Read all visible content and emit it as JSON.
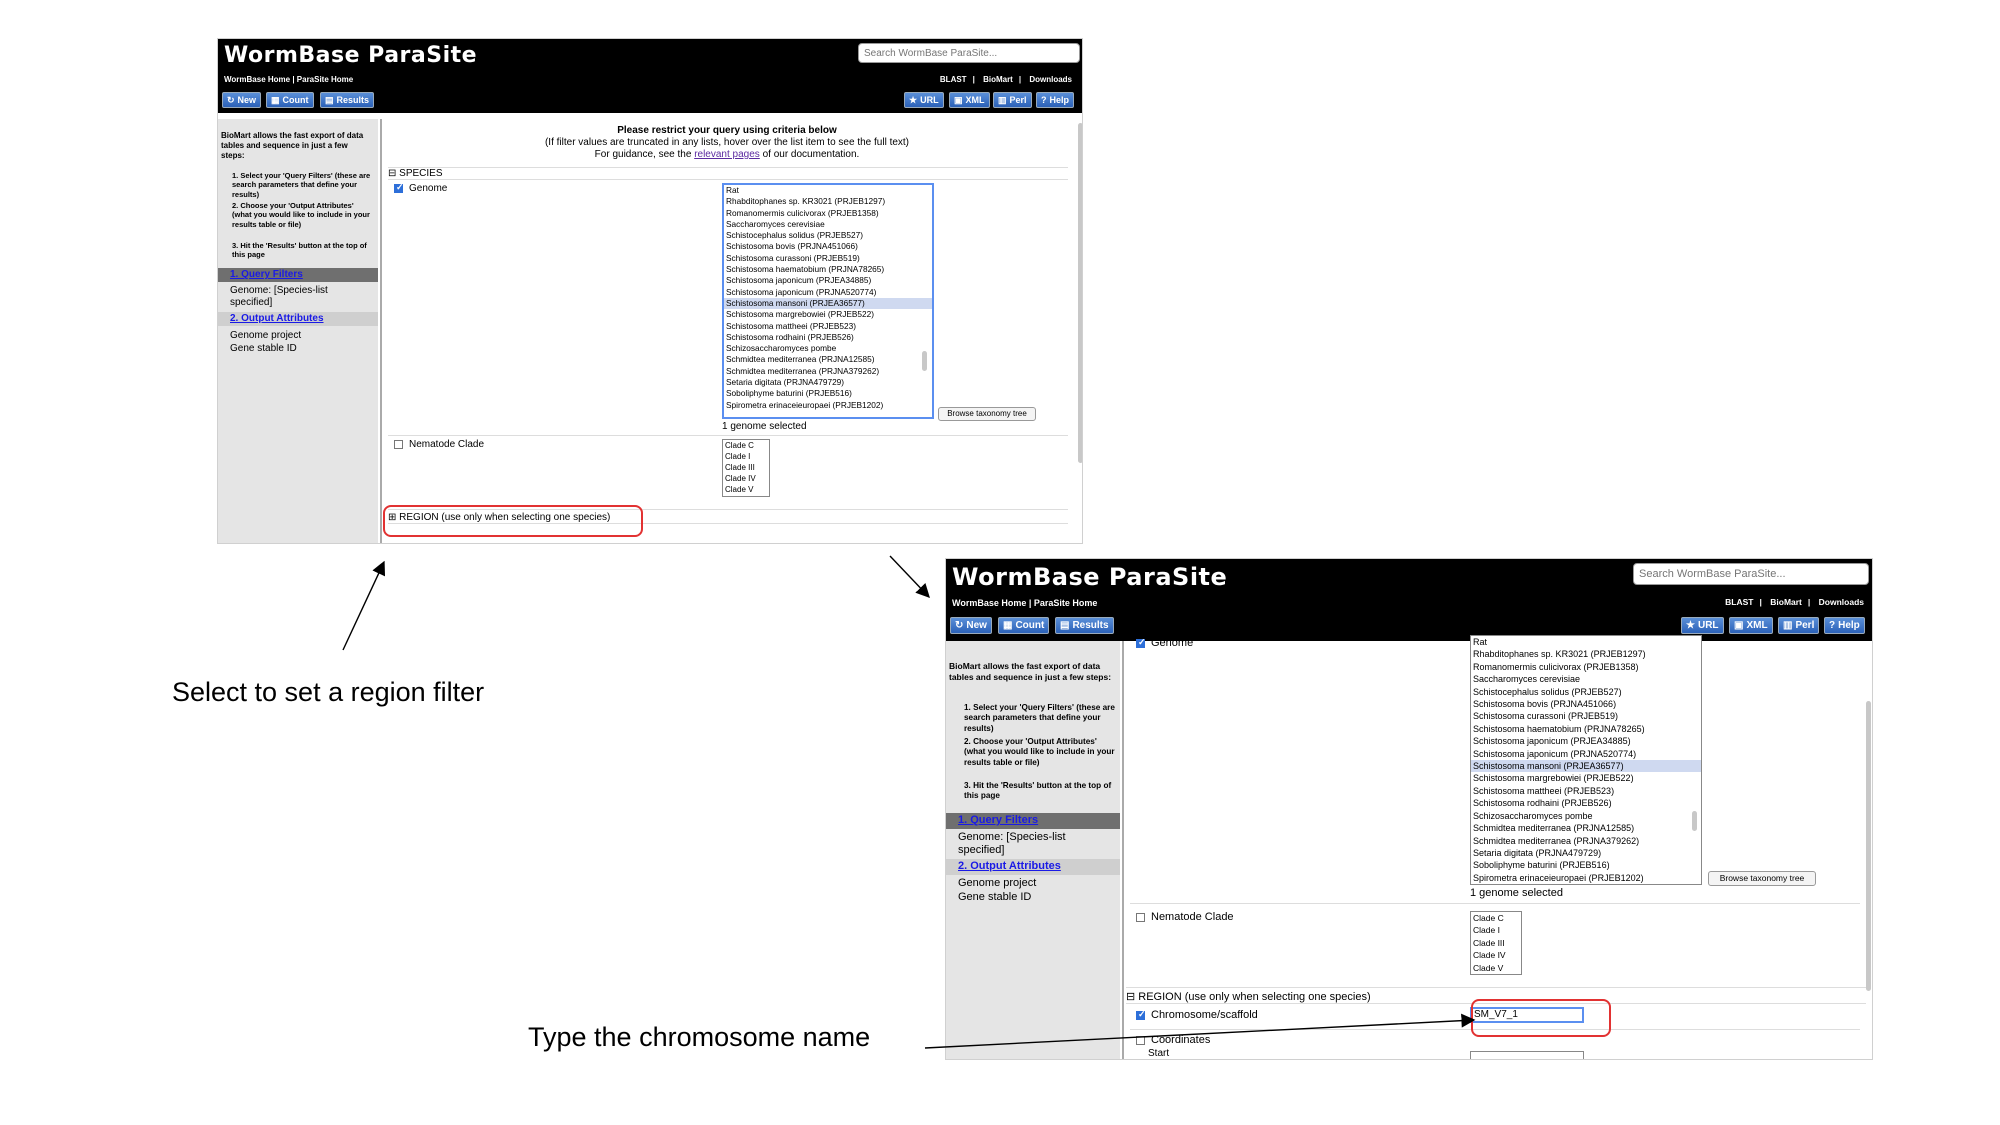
{
  "header": {
    "logo": "WormBase ParaSite",
    "toplinks": "WormBase Home | ParaSite Home",
    "search_placeholder": "Search WormBase ParaSite...",
    "nav": [
      "BLAST",
      "BioMart",
      "Downloads"
    ],
    "left_buttons": [
      "New",
      "Count",
      "Results"
    ],
    "right_buttons": [
      "URL",
      "XML",
      "Perl",
      "Help"
    ]
  },
  "sidebar": {
    "intro": "BioMart allows the fast export of data tables and sequence in just a few steps:",
    "steps": [
      "1. Select your 'Query Filters' (these are search parameters that define your results)",
      "2. Choose your 'Output Attributes' (what you would like to include in your results table or file)",
      "3. Hit the 'Results' button at the top of this page"
    ],
    "query_filters_link": "1. Query Filters",
    "query_filters_value": "Genome: [Species-list specified]",
    "output_attributes_link": "2. Output Attributes",
    "output_attributes_values": [
      "Genome project",
      "Gene stable ID"
    ]
  },
  "main": {
    "restrict_title": "Please restrict your query using criteria below",
    "restrict_note": "(If filter values are truncated in any lists, hover over the list item to see the full text)",
    "guidance_prefix": "For guidance, see the ",
    "guidance_link": "relevant pages",
    "guidance_suffix": " of our documentation.",
    "species_section": "⊟ SPECIES",
    "genome_label": "Genome",
    "genome_options": [
      "Rat",
      "Rhabditophanes sp. KR3021 (PRJEB1297)",
      "Romanomermis culicivorax (PRJEB1358)",
      "Saccharomyces cerevisiae",
      "Schistocephalus solidus (PRJEB527)",
      "Schistosoma bovis (PRJNA451066)",
      "Schistosoma curassoni (PRJEB519)",
      "Schistosoma haematobium (PRJNA78265)",
      "Schistosoma japonicum (PRJEA34885)",
      "Schistosoma japonicum (PRJNA520774)",
      "Schistosoma mansoni (PRJEA36577)",
      "Schistosoma margrebowiei (PRJEB522)",
      "Schistosoma mattheei (PRJEB523)",
      "Schistosoma rodhaini (PRJEB526)",
      "Schizosaccharomyces pombe",
      "Schmidtea mediterranea (PRJNA12585)",
      "Schmidtea mediterranea (PRJNA379262)",
      "Setaria digitata (PRJNA479729)",
      "Soboliphyme baturini (PRJEB516)",
      "Spirometra erinaceieuropaei (PRJEB1202)"
    ],
    "genome_selected_index": 10,
    "browse_button": "Browse taxonomy tree",
    "genome_count": "1 genome selected",
    "clade_label": "Nematode Clade",
    "clade_options": [
      "Clade C",
      "Clade I",
      "Clade III",
      "Clade IV",
      "Clade V"
    ],
    "region_section": "⊞ REGION (use only when selecting one species)",
    "region_section_open": "⊟ REGION (use only when selecting one species)",
    "chromosome_label": "Chromosome/scaffold",
    "chromosome_value": "SM_V7_1",
    "coordinates_label": "Coordinates",
    "start_label": "Start"
  },
  "annotations": {
    "region_hint": "Select to set a region filter",
    "chromosome_hint": "Type the chromosome name"
  },
  "colors": {
    "header_bg": "#000000",
    "button_blue": "#2b61b8",
    "highlight_red": "#e23232",
    "sidebar_bg": "#e5e5e5",
    "link_blue": "#1a1ae6"
  }
}
